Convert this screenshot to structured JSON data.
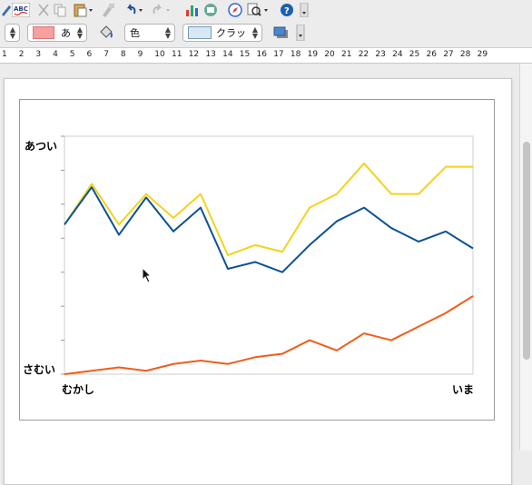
{
  "toolbar": {
    "spelling_icon_text": "ABC",
    "area_style": "あ",
    "line_color_label": "色",
    "line_style_label": "クラッ"
  },
  "ruler": [
    "1",
    "2",
    "3",
    "4",
    "5",
    "6",
    "7",
    "8",
    "9",
    "10",
    "11",
    "12",
    "13",
    "14",
    "15",
    "16",
    "17",
    "18",
    "19",
    "20",
    "21",
    "22",
    "23",
    "24",
    "25",
    "26",
    "27",
    "28",
    "29"
  ],
  "chart_data": {
    "type": "line",
    "title": "",
    "xlabel": "",
    "ylabel": "",
    "x": [
      0,
      1,
      2,
      3,
      4,
      5,
      6,
      7,
      8,
      9,
      10,
      11,
      12,
      13,
      14,
      15
    ],
    "x_tick_labels": {
      "start": "むかし",
      "end": "いま"
    },
    "y_tick_labels": {
      "top": "あつい",
      "bottom": "さむい"
    },
    "ylim": [
      0,
      70
    ],
    "grid": false,
    "series": [
      {
        "color": "#f5d21b",
        "values": [
          44,
          56,
          44,
          53,
          46,
          53,
          35,
          38,
          36,
          49,
          53,
          62,
          53,
          53,
          61,
          61
        ]
      },
      {
        "color": "#0a5296",
        "values": [
          44,
          55,
          41,
          52,
          42,
          49,
          31,
          33,
          30,
          38,
          45,
          49,
          43,
          39,
          42,
          37
        ]
      },
      {
        "color": "#f25c19",
        "values": [
          0,
          1,
          2,
          1,
          3,
          4,
          3,
          5,
          6,
          10,
          7,
          12,
          10,
          14,
          18,
          23
        ]
      }
    ]
  },
  "colors": {
    "selected_area_fill": "#f6a0a0",
    "selected_line_fill": "#d6e8f5"
  }
}
